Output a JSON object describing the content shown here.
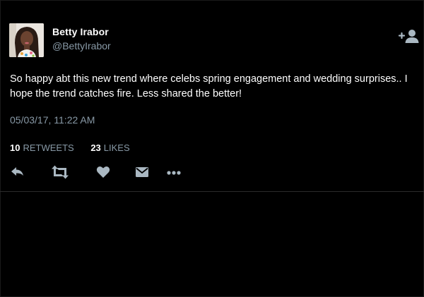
{
  "tweet": {
    "author_name": "Betty Irabor",
    "author_handle": "@BettyIrabor",
    "text": "So happy abt this new trend where celebs spring engagement and wedding surprises.. I hope the trend catches fire. Less shared the better!",
    "timestamp": "05/03/17, 11:22 AM",
    "retweets": {
      "count": "10",
      "label": "RETWEETS"
    },
    "likes": {
      "count": "23",
      "label": "LIKES"
    }
  },
  "colors": {
    "background": "#000000",
    "text": "#ffffff",
    "muted": "#8899a6",
    "icon": "#aab8c2",
    "divider": "#2b2b2b"
  },
  "icons": {
    "follow": "add-user-icon",
    "reply": "reply-icon",
    "retweet": "retweet-icon",
    "like": "heart-icon",
    "message": "envelope-icon",
    "more": "more-icon"
  }
}
